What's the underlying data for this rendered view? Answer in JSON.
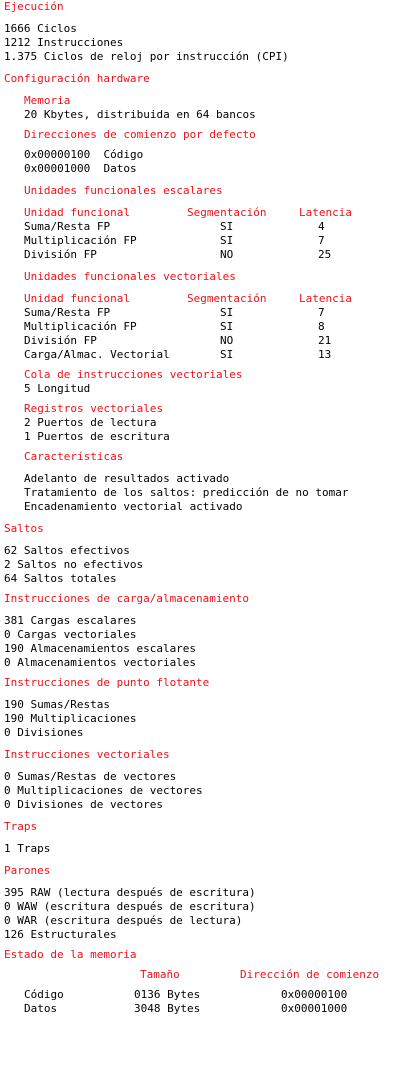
{
  "exec": {
    "title": "Ejecución",
    "lines": [
      "1666 Ciclos",
      "1212 Instrucciones",
      "1.375 Ciclos de reloj por instrucción (CPI)"
    ]
  },
  "hw": {
    "title": "Configuración hardware",
    "memory": {
      "title": "Memoria",
      "value": "20 Kbytes, distribuida en 64 bancos"
    },
    "addresses": {
      "title": "Direcciones de comienzo por defecto",
      "lines": [
        "0x00000100  Código",
        "0x00001000  Datos"
      ]
    },
    "scalar": {
      "title": "Unidades funcionales escalares",
      "headers": [
        "Unidad funcional",
        "Segmentación",
        "Latencia"
      ],
      "rows": [
        [
          "Suma/Resta FP",
          "SI",
          "4"
        ],
        [
          "Multiplicación FP",
          "SI",
          "7"
        ],
        [
          "División FP",
          "NO",
          "25"
        ]
      ]
    },
    "vector": {
      "title": "Unidades funcionales vectoriales",
      "headers": [
        "Unidad funcional",
        "Segmentación",
        "Latencia"
      ],
      "rows": [
        [
          "Suma/Resta FP",
          "SI",
          "7"
        ],
        [
          "Multiplicación FP",
          "SI",
          "8"
        ],
        [
          "División FP",
          "NO",
          "21"
        ],
        [
          "Carga/Almac. Vectorial",
          "SI",
          "13"
        ]
      ]
    },
    "queue": {
      "title": "Cola de instrucciones vectoriales",
      "value": "5 Longitud"
    },
    "vregs": {
      "title": "Registros vectoriales",
      "lines": [
        "2 Puertos de lectura",
        "1 Puertos de escritura"
      ]
    },
    "features": {
      "title": "Características",
      "lines": [
        "Adelanto de resultados activado",
        "Tratamiento de los saltos: predicción de no tomar",
        "Encadenamiento vectorial activado"
      ]
    }
  },
  "jumps": {
    "title": "Saltos",
    "lines": [
      "62 Saltos efectivos",
      "2 Saltos no efectivos",
      "64 Saltos totales"
    ]
  },
  "loadstore": {
    "title": "Instrucciones de carga/almacenamiento",
    "lines": [
      "381 Cargas escalares",
      "0 Cargas vectoriales",
      "190 Almacenamientos escalares",
      "0 Almacenamientos vectoriales"
    ]
  },
  "fp": {
    "title": "Instrucciones de punto flotante",
    "lines": [
      "190 Sumas/Restas",
      "190 Multiplicaciones",
      "0 Divisiones"
    ]
  },
  "vec": {
    "title": "Instrucciones vectoriales",
    "lines": [
      "0 Sumas/Restas de vectores",
      "0 Multiplicaciones de vectores",
      "0 Divisiones de vectores"
    ]
  },
  "traps": {
    "title": "Traps",
    "lines": [
      "1 Traps"
    ]
  },
  "stalls": {
    "title": "Parones",
    "lines": [
      "395 RAW (lectura después de escritura)",
      "0 WAW (escritura después de escritura)",
      "0 WAR (escritura después de lectura)",
      "126 Estructurales"
    ]
  },
  "memstate": {
    "title": "Estado de la memoria",
    "headers": [
      "Tamaño",
      "Dirección de comienzo"
    ],
    "rows": [
      [
        "Código",
        "0136 Bytes",
        "0x00000100"
      ],
      [
        "Datos",
        "3048 Bytes",
        "0x00001000"
      ]
    ]
  },
  "colors": {
    "heading": "#e8141c",
    "text": "#000000",
    "background": "#ffffff"
  }
}
